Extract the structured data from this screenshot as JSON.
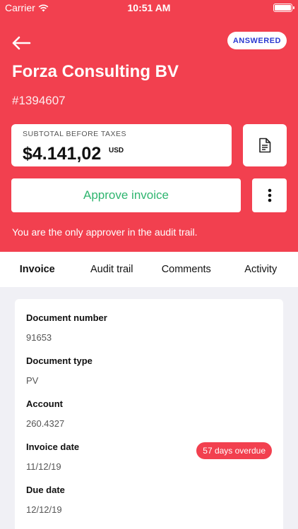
{
  "status_bar": {
    "carrier": "Carrier",
    "time": "10:51 AM",
    "wifi_icon": "wifi-icon",
    "battery_icon": "battery-icon"
  },
  "header": {
    "background": "#f2404f",
    "back_icon": "arrow-left-icon",
    "status_badge": "ANSWERED",
    "title": "Forza Consulting BV",
    "invoice_id": "#1394607",
    "subtotal": {
      "label": "SUBTOTAL BEFORE TAXES",
      "amount": "$4.141,02",
      "currency": "USD"
    },
    "document_icon": "document-icon",
    "approve_label": "Approve invoice",
    "more_icon": "more-vertical-icon",
    "approver_note": "You are the only approver in the audit trail."
  },
  "tabs": [
    {
      "label": "Invoice",
      "active": true
    },
    {
      "label": "Audit trail",
      "active": false
    },
    {
      "label": "Comments",
      "active": false
    },
    {
      "label": "Activity",
      "active": false
    }
  ],
  "details": {
    "document_number": {
      "label": "Document number",
      "value": "91653"
    },
    "document_type": {
      "label": "Document type",
      "value": "PV"
    },
    "account": {
      "label": "Account",
      "value": "260.4327"
    },
    "invoice_date": {
      "label": "Invoice date",
      "value": "11/12/19",
      "overdue_badge": "57 days overdue"
    },
    "due_date": {
      "label": "Due date",
      "value": "12/12/19"
    }
  },
  "colors": {
    "accent": "#f2404f",
    "approve": "#2fb56f",
    "badge_text": "#2b3ad1"
  }
}
